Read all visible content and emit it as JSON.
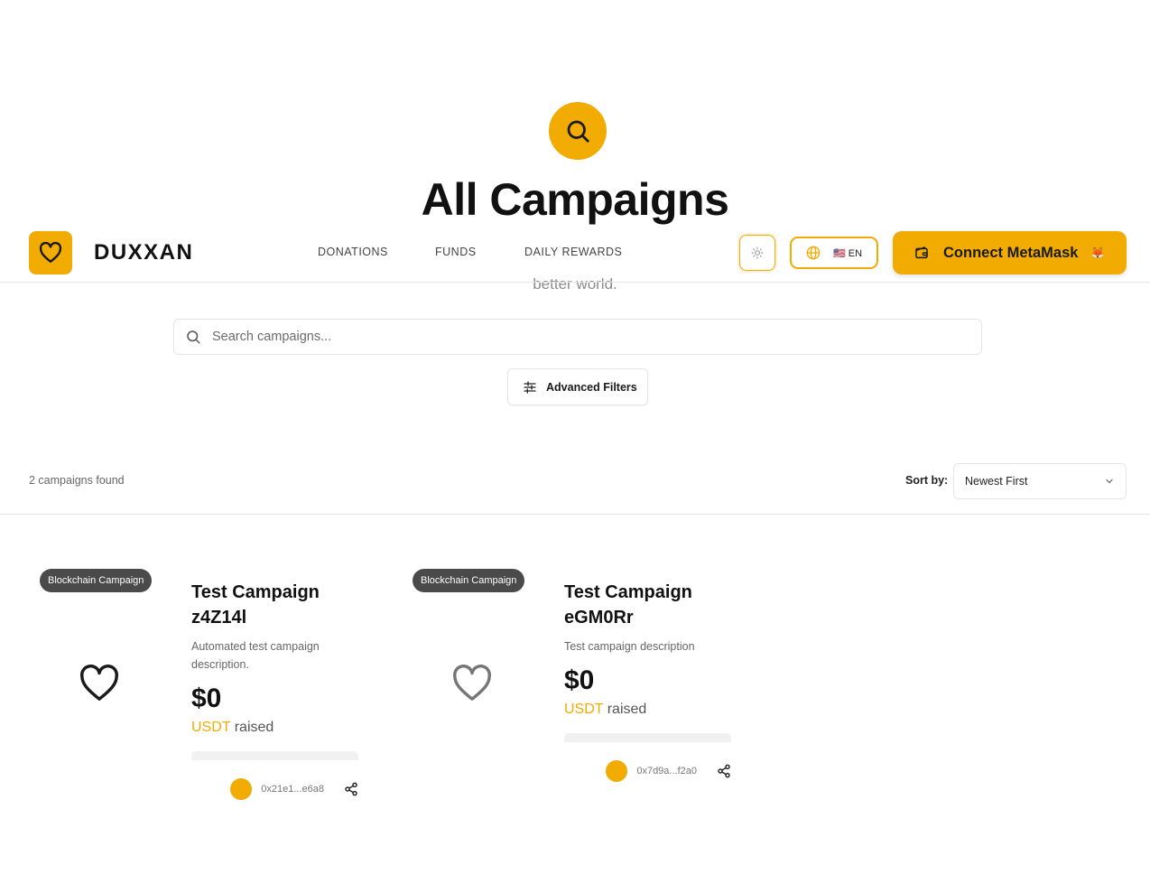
{
  "hero": {
    "title": "All Campaigns",
    "subtitle": "better world."
  },
  "header": {
    "brand": "DUXXAN",
    "nav": [
      "DONATIONS",
      "FUNDS",
      "DAILY REWARDS"
    ],
    "language": "🇺🇸 EN",
    "connect_label": "Connect MetaMask",
    "connect_emoji": "🦊"
  },
  "search": {
    "placeholder": "Search campaigns...",
    "filters_label": "Advanced Filters"
  },
  "results": {
    "count_text": "2 campaigns found",
    "sort_label": "Sort by:",
    "sort_value": "Newest First"
  },
  "campaigns": [
    {
      "category": "Blockchain Campaign",
      "title": "Test Campaign z4Z14l",
      "description": "Automated test campaign description.",
      "amount": "$0",
      "currency": "USDT",
      "raised_label": "raised",
      "creator": "0x21e1...e6a8",
      "progress": 0
    },
    {
      "category": "Blockchain Campaign",
      "title": "Test Campaign eGM0Rr",
      "description": "Test campaign description",
      "amount": "$0",
      "currency": "USDT",
      "raised_label": "raised",
      "creator": "0x7d9a...f2a0",
      "progress": 0
    }
  ],
  "colors": {
    "accent": "#f2ab00",
    "badge": "#4a4a4a"
  },
  "icons": {
    "hero": "search-icon",
    "logo": "heart-icon",
    "theme": "sun-icon",
    "language": "globe-icon",
    "wallet": "wallet-icon",
    "filters": "sliders-icon",
    "sort": "chevron-down-icon",
    "favorite": "heart-outline-icon",
    "share": "share-icon"
  }
}
